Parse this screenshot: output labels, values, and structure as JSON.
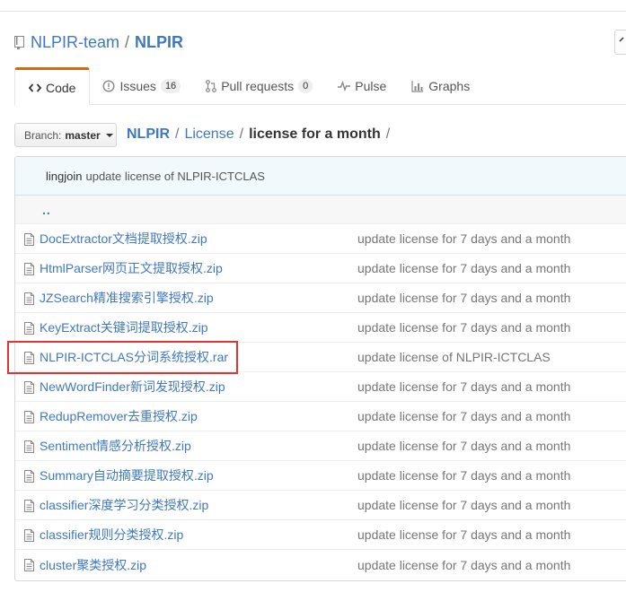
{
  "repo": {
    "owner": "NLPIR-team",
    "separator": "/",
    "name": "NLPIR"
  },
  "tabs": [
    {
      "label": "Code",
      "icon": "code-icon",
      "selected": true
    },
    {
      "label": "Issues",
      "icon": "issue-icon",
      "count": "16"
    },
    {
      "label": "Pull requests",
      "icon": "pull-request-icon",
      "count": "0"
    },
    {
      "label": "Pulse",
      "icon": "pulse-icon"
    },
    {
      "label": "Graphs",
      "icon": "graph-icon"
    }
  ],
  "branch": {
    "label": "Branch:",
    "name": "master"
  },
  "breadcrumb": {
    "root": "NLPIR",
    "sep": "/",
    "folder": "License",
    "current": "license for a month",
    "trailing": "/"
  },
  "commit": {
    "author": "lingjoin",
    "message": "update license of NLPIR-ICTCLAS"
  },
  "up_link": "..",
  "files": [
    {
      "name": "DocExtractor文档提取授权.zip",
      "message": "update license for 7 days and a month"
    },
    {
      "name": "HtmlParser网页正文提取授权.zip",
      "message": "update license for 7 days and a month"
    },
    {
      "name": "JZSearch精准搜索引擎授权.zip",
      "message": "update license for 7 days and a month"
    },
    {
      "name": "KeyExtract关键词提取授权.zip",
      "message": "update license for 7 days and a month"
    },
    {
      "name": "NLPIR-ICTCLAS分词系统授权.rar",
      "message": "update license of NLPIR-ICTCLAS",
      "highlighted": true
    },
    {
      "name": "NewWordFinder新词发现授权.zip",
      "message": "update license for 7 days and a month"
    },
    {
      "name": "RedupRemover去重授权.zip",
      "message": "update license for 7 days and a month"
    },
    {
      "name": "Sentiment情感分析授权.zip",
      "message": "update license for 7 days and a month"
    },
    {
      "name": "Summary自动摘要提取授权.zip",
      "message": "update license for 7 days and a month"
    },
    {
      "name": "classifier深度学习分类授权.zip",
      "message": "update license for 7 days and a month"
    },
    {
      "name": "classifier规则分类授权.zip",
      "message": "update license for 7 days and a month"
    },
    {
      "name": "cluster聚类授权.zip",
      "message": "update license for 7 days and a month"
    }
  ],
  "colors": {
    "link": "#4078c0",
    "tab_accent": "#d26911",
    "highlight": "#e53232"
  }
}
